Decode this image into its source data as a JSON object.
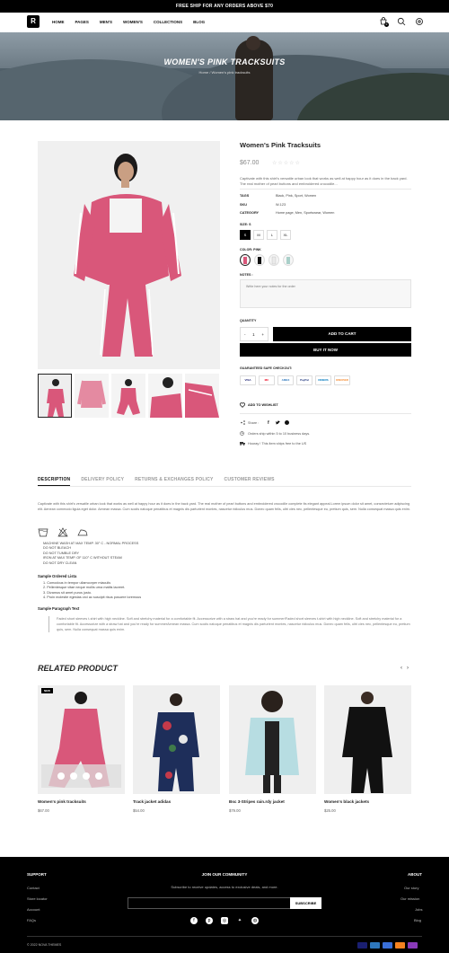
{
  "announcement": "FREE SHIP FOR ANY ORDERS ABOVE $70",
  "header": {
    "nav": [
      "HOME",
      "PAGES",
      "MEN'S",
      "WOMEN'S",
      "COLLECTIONS",
      "BLOG"
    ],
    "cart_count": "0"
  },
  "hero": {
    "title": "WOMEN'S PINK TRACKSUITS",
    "breadcrumb": "Home  /  Women's pink tracksuits"
  },
  "product": {
    "title": "Women's Pink Tracksuits",
    "price": "$67.00",
    "stars": "☆☆☆☆☆",
    "description": "Captivate with this shirt's versatile urban look that works as well at happy hour as it does in the back yard. The real mother of pearl buttons and embroidered crocodile...",
    "meta": [
      {
        "k": "TAGS",
        "v": "Black, Pink, Sport, Women"
      },
      {
        "k": "SKU",
        "v": "W-123"
      },
      {
        "k": "CATEGORY",
        "v": "Home page, Men, Sportswear, Women"
      }
    ],
    "size_label": "SIZE: S",
    "sizes": [
      "S",
      "M",
      "L",
      "XL"
    ],
    "color_label": "COLOR: PINK",
    "notes_label": "NOTES :",
    "notes_placeholder": "Write here your notes for the order",
    "quantity_label": "QUANTITY",
    "qty": "1",
    "minus": "-",
    "plus": "+",
    "add_to_cart": "ADD TO CART",
    "buy_now": "BUY IT NOW",
    "checkout_label": "GUARANTEED SAFE CHECKOUT:",
    "payments": [
      "VISA",
      "MC",
      "AMEX",
      "PayPal",
      "DINERS",
      "DISCOVER"
    ],
    "wishlist": "ADD TO WISHLIST",
    "share": "Share :",
    "shipping": "Orders ship within 5 to 10 business days.",
    "delivery": "Hooray ! This item ships free to the US"
  },
  "tabs": [
    "DESCRIPTION",
    "DELIVERY POLICY",
    "RETURNS & EXCHANGES POLICY",
    "CUSTOMER REVIEWS"
  ],
  "description": {
    "intro": "Captivate with this shirt's versatile urban look that works as well at happy hour as it does in the back yard. The real mother of pearl buttons and embroidered crocodile complete its elegant appeal.Lorem ipsum dolor sit amet, consectetuer adipiscing elit. Aenean commodo ligula eget dolor. Aenean massa. Cum sociis natoque penatibus et magnis dis parturient montes, nascetur ridiculus mus. Donec quam felis, ultri cies nec, pellentesque eu, pretium quis, sem. Nulla consequat massa quis enim.",
    "care": [
      "MACHINE WASH AT MAX TEMP. 30° C - NORMAL PROCESS",
      "DO NOT BLEACH",
      "DO NOT TUMBLE DRY",
      "IRON AT MAX TEMP. OF 110° C WITHOUT STEAM",
      "DO NOT DRY CLEAN"
    ],
    "ol_title": "Sample Ordered Lista",
    "ol": [
      "1. Comodous in tempor ullamcorper miaculis",
      "2. Pellentesque vitae neque mollis urna mattis laoreet.",
      "3. Divamus sit amet purus justo.",
      "4. Proin molestie egestas orci ac suscipit risus posuere loremous"
    ],
    "para_title": "Sample Paragraph Text",
    "quote": "Faded short sleeves t-shirt with high neckline. Soft and stretchy material for a comfortable fit. Accessorize with a straw hat and you're ready for summer!Faded short sleeves t-shirt with high neckline. Soft and stretchy material for a comfortable fit. Accessorize with a straw hat and you're ready for summerAenean massa. Cum sociis natoque penatibus et magnis dis parturient montes, nascetur ridiculus mus. Donec quam felis, ultri cies nec, pellentesque eu, pretium quis, sem. Nulla consequat massa quis enim."
  },
  "related": {
    "title": "RELATED PRODUCT",
    "badge": "NEW",
    "items": [
      {
        "name": "Women's pink tracksuits",
        "price": "$67.00"
      },
      {
        "name": "Track jacket adidas",
        "price": "$54.00"
      },
      {
        "name": "Bsc 3-Stripes rain.rdy jacket",
        "price": "$79.00"
      },
      {
        "name": "Women's black jackets",
        "price": "$25.00"
      }
    ]
  },
  "footer": {
    "support_title": "SUPPORT",
    "support": [
      "Contact",
      "Store locator",
      "Account",
      "FAQs"
    ],
    "community_title": "JOIN OUR COMMUNITY",
    "community_text": "Subscribe to receive updates, access to exclusive deals, and more.",
    "subscribe": "SUBSCRIBE",
    "about_title": "ABOUT",
    "about": [
      "Our story",
      "Our mission",
      "Jobs",
      "Blog"
    ],
    "copyright": "© 2022 NOVA THEMES"
  },
  "colors": {
    "accent": "#000000",
    "pink": "#d9577a",
    "footer": "#000000"
  }
}
